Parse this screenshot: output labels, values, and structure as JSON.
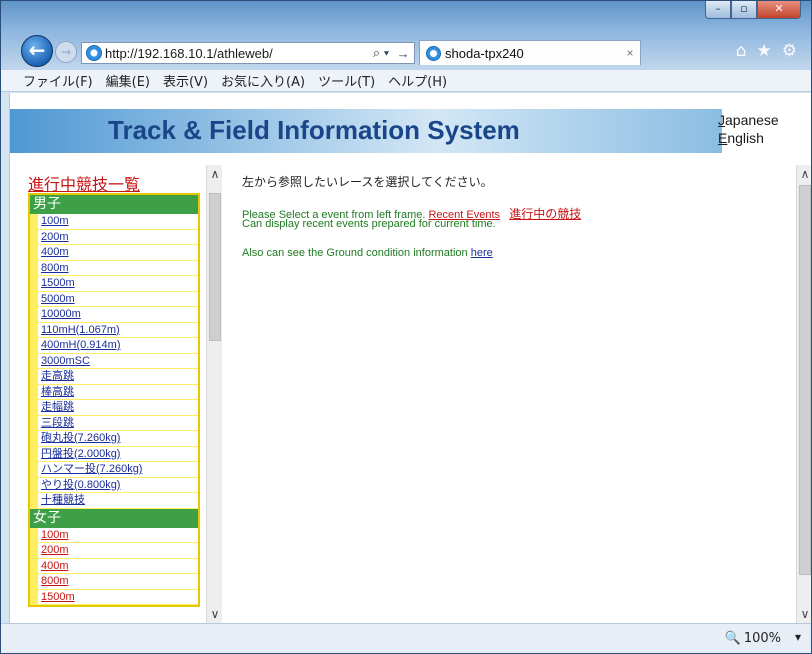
{
  "browser": {
    "url": "http://192.168.10.1/athleweb/",
    "search_glyph": "⌕ ▾",
    "go_glyph": "→",
    "tab_title": "shoda-tpx240",
    "tab_close": "×"
  },
  "menu": [
    "ファイル(F)",
    "編集(E)",
    "表示(V)",
    "お気に入り(A)",
    "ツール(T)",
    "ヘルプ(H)"
  ],
  "header": {
    "title": "Track & Field Information System",
    "lang_japanese": "Japanese",
    "lang_english": "English"
  },
  "left": {
    "heading": "進行中競技一覧",
    "men_label": "男子",
    "men_events": [
      "100m",
      "200m",
      "400m",
      "800m",
      "1500m",
      "5000m",
      "10000m",
      "110mH(1.067m)",
      "400mH(0.914m)",
      "3000mSC",
      "走高跳",
      "棒高跳",
      "走幅跳",
      "三段跳",
      "砲丸投(7.260kg)",
      "円盤投(2.000kg)",
      "ハンマー投(7.260kg)",
      "やり投(0.800kg)",
      "十種競技"
    ],
    "women_label": "女子",
    "women_events": [
      "100m",
      "200m",
      "400m",
      "800m",
      "1500m"
    ]
  },
  "right": {
    "prompt_ja": "左から参照したいレースを選択してください。",
    "line1_text": "Please Select a event from left frame.",
    "line1_link": "Recent Events",
    "line1_link_ja": "進行中の競技",
    "line2_text": "Can display recent events prepared for current time.",
    "line3_text": "Also can see the Ground condition information",
    "line3_link": "here"
  },
  "status": {
    "zoom": "100%"
  },
  "colors": {
    "men_header": "#3ea046",
    "list_bg": "#ffee60",
    "title": "#1a4689",
    "link_red": "#c81414",
    "link_blue": "#1b2f9b"
  }
}
